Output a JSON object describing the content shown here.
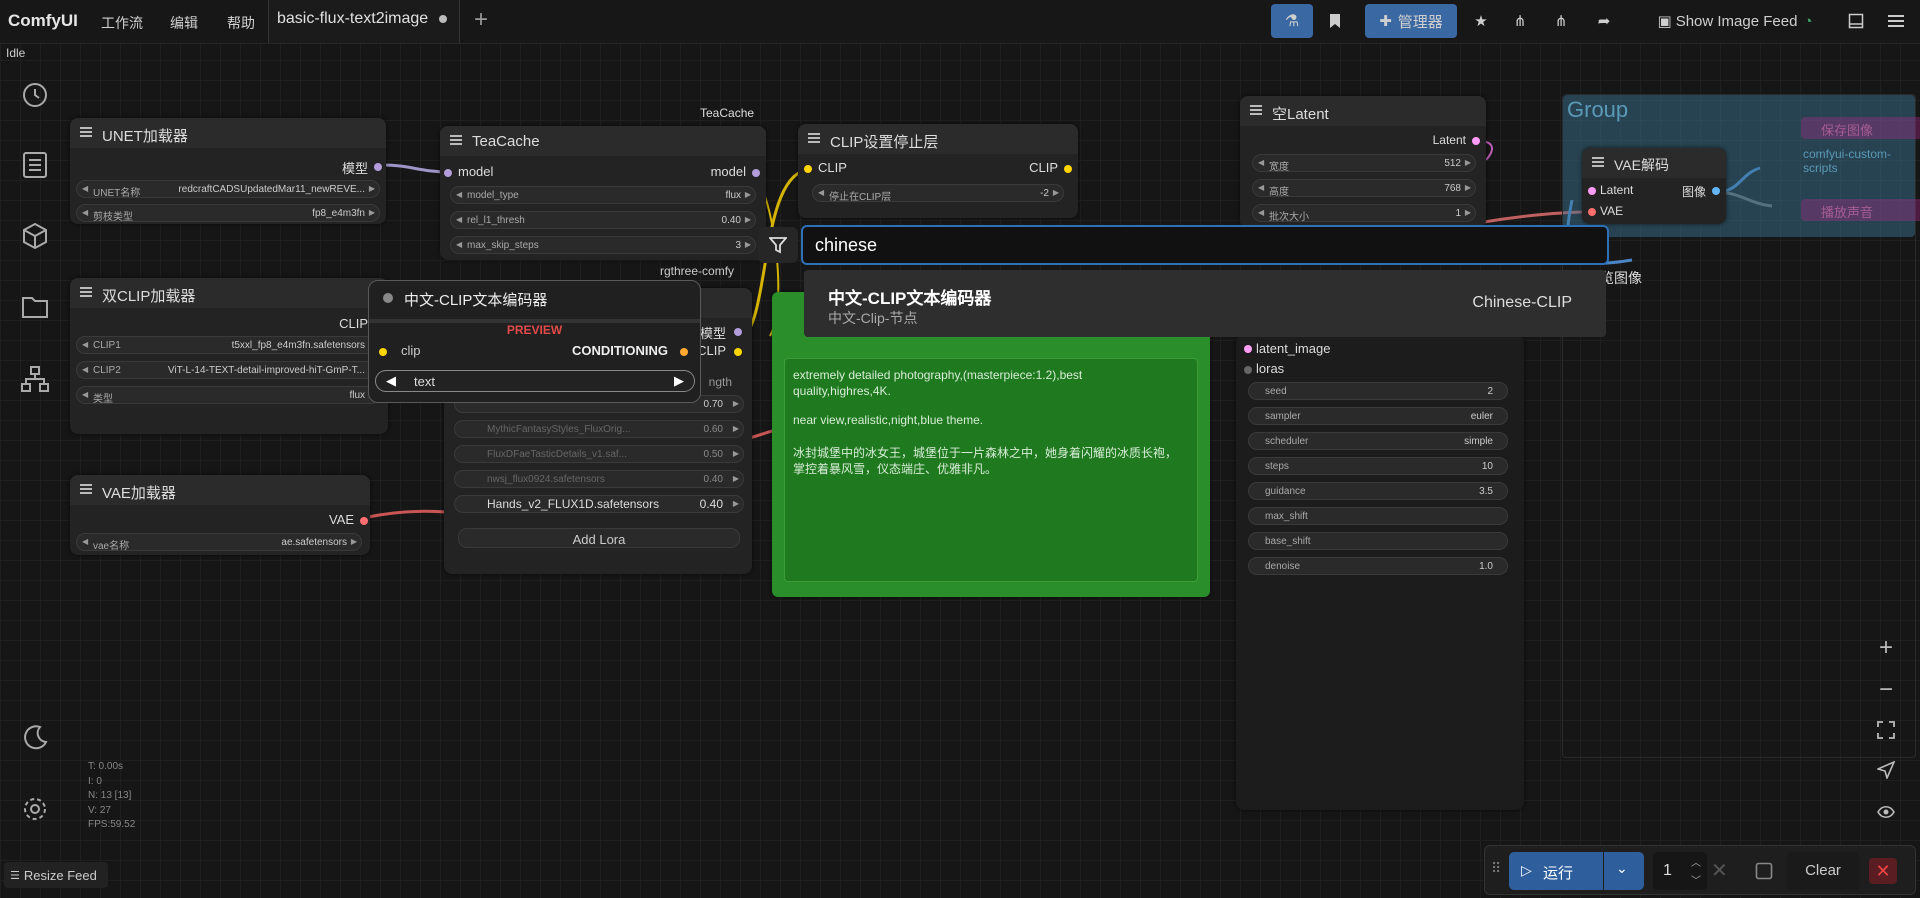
{
  "app": {
    "brand": "ComfyUI",
    "menu": [
      "工作流",
      "编辑",
      "帮助"
    ],
    "status": "Idle"
  },
  "tab": {
    "label": "basic-flux-text2image"
  },
  "toolbar": {
    "manager_label": "管理器",
    "image_feed_label": "Show Image Feed"
  },
  "nodes": {
    "unet": {
      "title": "UNET加载器",
      "output": "模型",
      "widgets": [
        {
          "label": "UNET名称",
          "value": "redcraftCADSUpdatedMar11_newREVE..."
        },
        {
          "label": "剪枝类型",
          "value": "fp8_e4m3fn"
        }
      ]
    },
    "teacache": {
      "group_label": "TeaCache",
      "title": "TeaCache",
      "input": "model",
      "output": "model",
      "widgets": [
        {
          "label": "model_type",
          "value": "flux"
        },
        {
          "label": "rel_l1_thresh",
          "value": "0.40"
        },
        {
          "label": "max_skip_steps",
          "value": "3"
        }
      ]
    },
    "clip_stop": {
      "title": "CLIP设置停止层",
      "input": "CLIP",
      "output": "CLIP",
      "widgets": [
        {
          "label": "停止在CLIP层",
          "value": "-2"
        }
      ]
    },
    "dual_clip": {
      "title": "双CLIP加载器",
      "output": "CLIP",
      "widgets": [
        {
          "label": "CLIP1",
          "value": "t5xxl_fp8_e4m3fn.safetensors"
        },
        {
          "label": "CLIP2",
          "value": "ViT-L-14-TEXT-detail-improved-hiT-GmP-T..."
        },
        {
          "label": "类型",
          "value": "flux"
        }
      ]
    },
    "vae_loader": {
      "title": "VAE加载器",
      "output": "VAE",
      "widgets": [
        {
          "label": "vae名称",
          "value": "ae.safetensors"
        }
      ]
    },
    "lora": {
      "group_label": "rgthree-comfy",
      "output_model": "模型",
      "output_clip": "CLIP",
      "partial_label": "ngth",
      "items": [
        {
          "label": "MythicFantasyStyles_FluxOrig...",
          "value": "0.60"
        },
        {
          "label": "FluxDFaeTasticDetails_v1.saf...",
          "value": "0.50"
        },
        {
          "label": "nwsj_flux0924.safetensors",
          "value": "0.40"
        },
        {
          "label": "Hands_v2_FLUX1D.safetensors",
          "value": "0.40"
        }
      ],
      "partial_value": "0.70",
      "add_label": "Add Lora"
    },
    "empty_latent": {
      "title": "空Latent",
      "output": "Latent",
      "widgets": [
        {
          "label": "宽度",
          "value": "512"
        },
        {
          "label": "高度",
          "value": "768"
        },
        {
          "label": "批次大小",
          "value": "1"
        }
      ]
    },
    "vae_decode": {
      "title": "VAE解码",
      "input1": "Latent",
      "input2": "VAE",
      "output": "图像"
    },
    "group": {
      "title": "Group",
      "save_label": "保存图像",
      "custom_label": "comfyui-custom-scripts",
      "sound_label": "播放声音"
    },
    "preview_image": {
      "partial_title": "览图像"
    },
    "text_node": {
      "prompt_lines": [
        "extremely detailed photography,(masterpiece:1.2),best quality,highres,4K.",
        "near view,realistic,night,blue theme.",
        "冰封城堡中的冰女王，城堡位于一片森林之中，她身着闪耀的冰质长袍，掌控着暴风雪，仪态端庄、优雅非凡。"
      ]
    },
    "sampler": {
      "inputs": [
        "latent_image",
        "loras"
      ],
      "widgets": [
        {
          "label": "seed",
          "value": "2"
        },
        {
          "label": "sampler",
          "value": "euler"
        },
        {
          "label": "scheduler",
          "value": "simple"
        },
        {
          "label": "steps",
          "value": "10"
        },
        {
          "label": "guidance",
          "value": "3.5"
        },
        {
          "label": "max_shift",
          "value": ""
        },
        {
          "label": "base_shift",
          "value": ""
        },
        {
          "label": "denoise",
          "value": "1.0"
        }
      ]
    }
  },
  "search": {
    "query": "chinese",
    "result": {
      "title": "中文-CLIP文本编码器",
      "subtitle": "中文-Clip-节点",
      "category": "Chinese-CLIP"
    }
  },
  "preview": {
    "title": "中文-CLIP文本编码器",
    "badge": "PREVIEW",
    "input": "clip",
    "output": "CONDITIONING",
    "widget": "text"
  },
  "runbar": {
    "run_label": "运行",
    "count": "1",
    "clear_label": "Clear"
  },
  "stats": [
    "T: 0.00s",
    "I: 0",
    "N: 13 [13]",
    "V: 27",
    "FPS:59.52"
  ],
  "resize_label": "Resize Feed",
  "colors": {
    "accent": "#2e70b8",
    "model_wire": "#b39ddb",
    "clip_wire": "#ffd500",
    "vae_wire": "#ff6e6e",
    "latent_wire": "#ff9cf9",
    "image_wire": "#64b5f6",
    "green_node": "#2a8f2a"
  }
}
